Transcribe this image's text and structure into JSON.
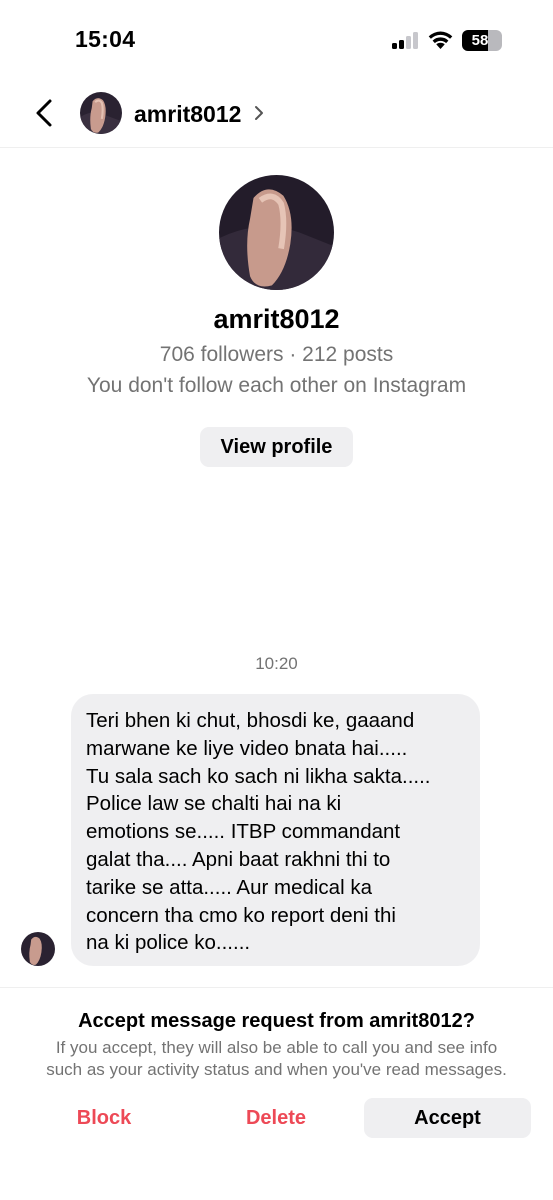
{
  "status_bar": {
    "time": "15:04",
    "battery_level": "58"
  },
  "header": {
    "username": "amrit8012"
  },
  "profile": {
    "username": "amrit8012",
    "stats": "706 followers · 212 posts",
    "mutual": "You don't follow each other on Instagram",
    "view_profile_label": "View profile"
  },
  "conversation": {
    "timestamp": "10:20",
    "message_lines": [
      "Teri bhen ki chut, bhosdi ke, gaaand",
      "marwane ke liye video bnata hai.....",
      "Tu sala sach ko sach ni likha sakta.....",
      "Police law se chalti hai na ki",
      "emotions se..... ITBP commandant",
      "galat tha.... Apni baat rakhni thi to",
      "tarike se atta..... Aur medical ka",
      "concern tha cmo ko report deni thi",
      "na ki police ko......"
    ]
  },
  "request": {
    "title": "Accept message request from amrit8012?",
    "info_lines": [
      "If you accept, they will also be able to call you and see info",
      "such as your activity status and when you've read messages."
    ],
    "block_label": "Block",
    "delete_label": "Delete",
    "accept_label": "Accept"
  },
  "colors": {
    "destructive": "#ed4956",
    "secondary_text": "#737373",
    "bubble_bg": "#efeff1"
  },
  "icons": [
    "back-arrow-icon",
    "chevron-right-icon",
    "signal-icon",
    "wifi-icon",
    "battery-icon"
  ]
}
